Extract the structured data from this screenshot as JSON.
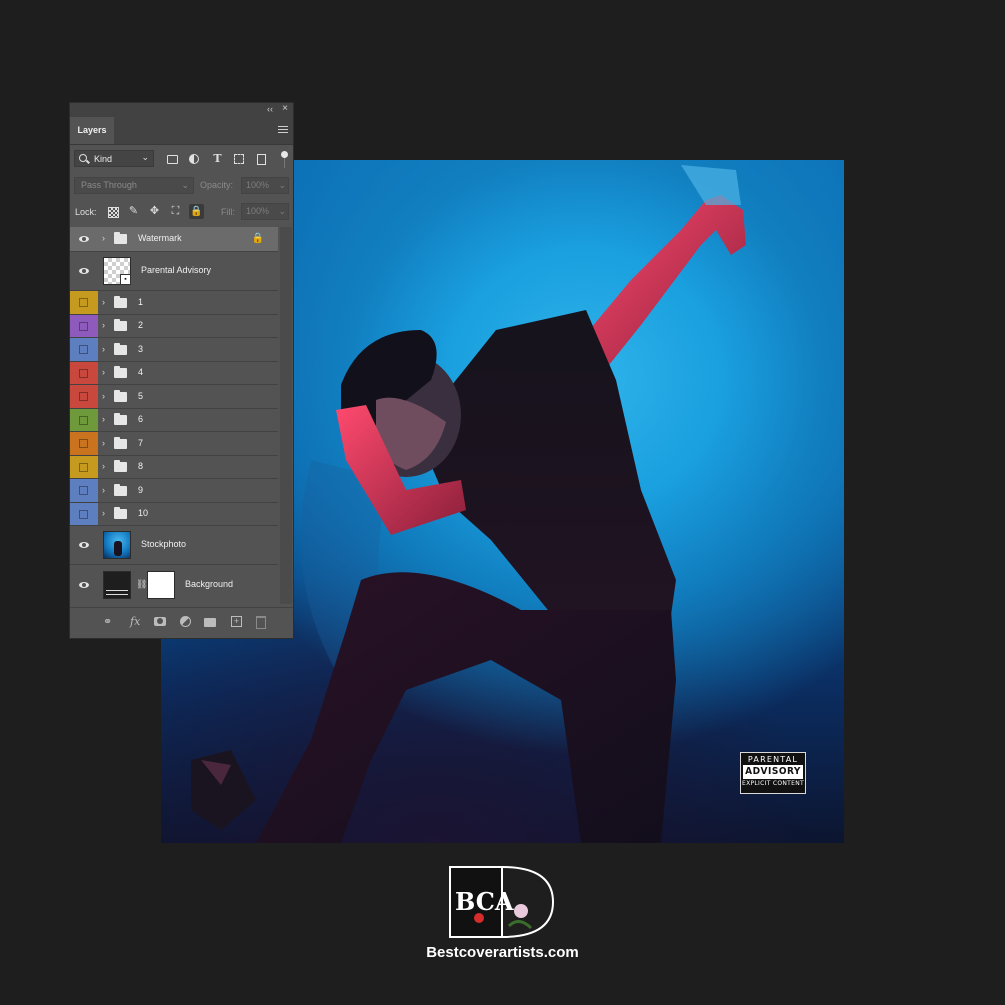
{
  "panel": {
    "collapse_glyph": "‹‹",
    "close_glyph": "×",
    "tab_label": "Layers",
    "filter_kind": "Kind",
    "blend_mode": "Pass Through",
    "opacity_label": "Opacity:",
    "opacity_value": "100%",
    "lock_label": "Lock:",
    "fill_label": "Fill:",
    "fill_value": "100%",
    "fx_label": "fx"
  },
  "layers": [
    {
      "name": "Watermark",
      "type": "group",
      "visible": true,
      "locked": true,
      "selected": true
    },
    {
      "name": "Parental Advisory",
      "type": "smart-object",
      "visible": true
    },
    {
      "name": "1",
      "type": "group",
      "color": "#c59a1e"
    },
    {
      "name": "2",
      "type": "group",
      "color": "#8e5bbd"
    },
    {
      "name": "3",
      "type": "group",
      "color": "#5d7fbf"
    },
    {
      "name": "4",
      "type": "group",
      "color": "#c8483d"
    },
    {
      "name": "5",
      "type": "group",
      "color": "#c8483d"
    },
    {
      "name": "6",
      "type": "group",
      "color": "#6e9a3c"
    },
    {
      "name": "7",
      "type": "group",
      "color": "#c9731f"
    },
    {
      "name": "8",
      "type": "group",
      "color": "#c59a1e"
    },
    {
      "name": "9",
      "type": "group",
      "color": "#5d7fbf"
    },
    {
      "name": "10",
      "type": "group",
      "color": "#5d7fbf"
    },
    {
      "name": "Stockphoto",
      "type": "image",
      "visible": true
    },
    {
      "name": "Background",
      "type": "image-with-mask",
      "visible": true
    }
  ],
  "artwork": {
    "advisory_top": "PARENTAL",
    "advisory_mid": "ADVISORY",
    "advisory_bottom": "EXPLICIT CONTENT"
  },
  "brand": {
    "logo_text": "BCA",
    "site": "Bestcoverartists.com"
  }
}
